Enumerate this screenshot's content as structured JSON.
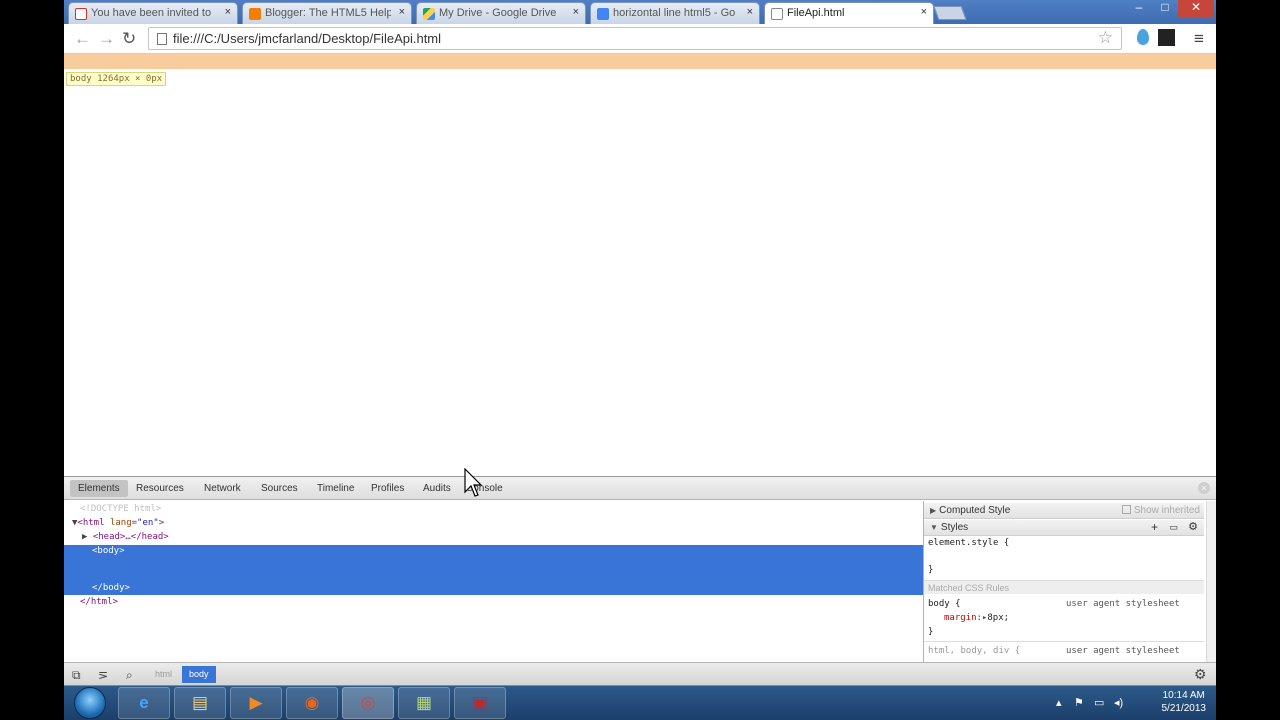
{
  "tabs": [
    {
      "label": "You have been invited to",
      "favicon": "gmail-icon",
      "color": "#d93025"
    },
    {
      "label": "Blogger: The HTML5 Help",
      "favicon": "blogger-icon",
      "color": "#f57d00"
    },
    {
      "label": "My Drive - Google Drive",
      "favicon": "drive-icon",
      "color": "#1fa463"
    },
    {
      "label": "horizontal line html5 - Go",
      "favicon": "google-search-icon",
      "color": "#4285f4"
    },
    {
      "label": "FileApi.html",
      "favicon": "page-icon",
      "color": "#ffffff"
    }
  ],
  "tab_close_glyph": "×",
  "window_controls": {
    "minimize": "–",
    "maximize": "□",
    "close": "✕"
  },
  "toolbar": {
    "back_glyph": "←",
    "forward_glyph": "→",
    "reload_glyph": "↻",
    "url": "file:///C:/Users/jmcfarland/Desktop/FileApi.html",
    "star_glyph": "☆",
    "menu_glyph": "≡"
  },
  "viewport": {
    "tooltip_tag": "body",
    "tooltip_size": "1264px × 0px",
    "margin_highlight_color": "#f9cc9d"
  },
  "devtools": {
    "tabs": [
      "Elements",
      "Resources",
      "Network",
      "Sources",
      "Timeline",
      "Profiles",
      "Audits",
      "Console"
    ],
    "selected_tab": "Elements",
    "dom": {
      "doctype": "<!DOCTYPE html>",
      "html_open_tag": "<html",
      "html_attr_name": "lang",
      "html_attr_value": "\"en\"",
      "html_open_end": ">",
      "head_collapsed": "<head>…</head>",
      "body_open": "<body>",
      "body_close": "</body>",
      "html_close": "</html>"
    },
    "sidebar": {
      "computed_title": "Computed Style",
      "show_inherited": "Show inherited",
      "styles_title": "Styles",
      "element_style": "element.style {",
      "element_style_close": "}",
      "matched_rules": "Matched CSS Rules",
      "rule1_selector": "body {",
      "rule1_source": "user agent stylesheet",
      "rule1_prop": "margin:",
      "rule1_value": "8px;",
      "rule1_close": "}",
      "rule2_selector": "html, body, div {",
      "rule2_source": "user agent stylesheet"
    },
    "breadcrumbs": [
      "html",
      "body"
    ],
    "selected_crumb": "body"
  },
  "taskbar": {
    "apps": [
      {
        "name": "ie-icon",
        "glyph": "e"
      },
      {
        "name": "folder-icon",
        "glyph": "▤"
      },
      {
        "name": "media-player-icon",
        "glyph": "▶"
      },
      {
        "name": "firefox-icon",
        "glyph": "◉"
      },
      {
        "name": "chrome-icon",
        "glyph": "◎"
      },
      {
        "name": "notes-icon",
        "glyph": "▦"
      },
      {
        "name": "app-icon",
        "glyph": "▣"
      }
    ],
    "clock_time": "10:14 AM",
    "clock_date": "5/21/2013"
  }
}
